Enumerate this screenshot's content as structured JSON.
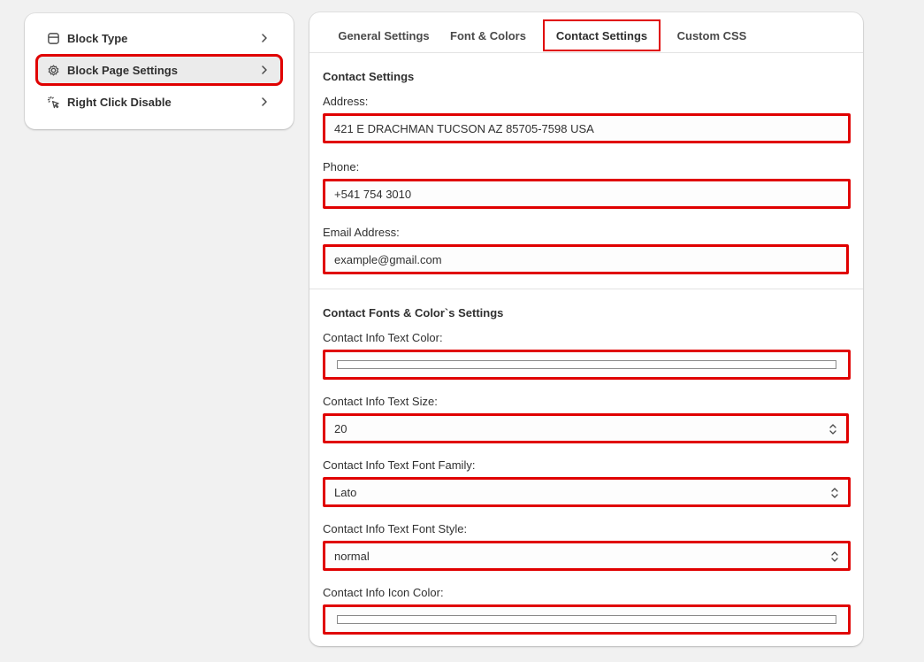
{
  "sidebar": {
    "items": [
      {
        "label": "Block Type",
        "icon": "layout-block-icon"
      },
      {
        "label": "Block Page Settings",
        "icon": "gear-icon"
      },
      {
        "label": "Right Click Disable",
        "icon": "cursor-click-icon"
      }
    ],
    "active_index": 1
  },
  "tabs": [
    {
      "label": "General Settings"
    },
    {
      "label": "Font & Colors"
    },
    {
      "label": "Contact Settings"
    },
    {
      "label": "Custom CSS"
    }
  ],
  "active_tab": "Contact Settings",
  "contact": {
    "title": "Contact Settings",
    "address_label": "Address:",
    "address_value": "421 E DRACHMAN TUCSON AZ 85705-7598 USA",
    "phone_label": "Phone:",
    "phone_value": "+541 754 3010",
    "email_label": "Email Address:",
    "email_value": "example@gmail.com"
  },
  "fonts": {
    "title": "Contact Fonts & Color`s Settings",
    "text_color_label": "Contact Info Text Color:",
    "text_size_label": "Contact Info Text Size:",
    "text_size_value": "20",
    "font_family_label": "Contact Info Text Font Family:",
    "font_family_value": "Lato",
    "font_style_label": "Contact Info Text Font Style:",
    "font_style_value": "normal",
    "icon_color_label": "Contact Info Icon Color:"
  },
  "colors": {
    "highlight": "#e00000",
    "background": "#f1f1f1",
    "card": "#ffffff"
  }
}
